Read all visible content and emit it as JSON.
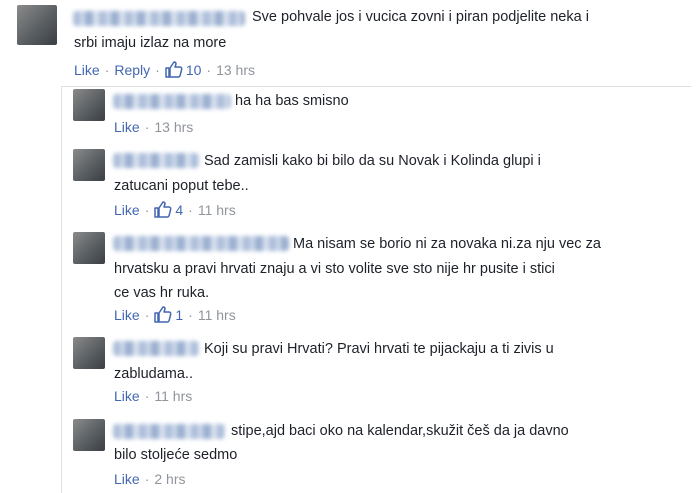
{
  "comments": [
    {
      "text_lines": [
        "Sve pohvale jos i vucica zovni i piran podjelite neka i",
        "srbi imaju izlaz na more"
      ],
      "like_label": "Like",
      "reply_label": "Reply",
      "like_count": "10",
      "time": "13 hrs"
    },
    {
      "text_lines": [
        "ha ha bas smisno"
      ],
      "like_label": "Like",
      "time": "13 hrs"
    },
    {
      "text_lines": [
        "Sad zamisli kako bi bilo da su Novak i Kolinda glupi i",
        "zatucani poput tebe.."
      ],
      "like_label": "Like",
      "like_count": "4",
      "time": "11 hrs"
    },
    {
      "text_lines": [
        "Ma nisam se borio ni za novaka ni.za nju vec za",
        "hrvatsku a pravi hrvati znaju a vi sto volite sve sto nije hr pusite i stici",
        "ce vas hr ruka."
      ],
      "like_label": "Like",
      "like_count": "1",
      "time": "11 hrs"
    },
    {
      "text_lines": [
        "Koji su pravi Hrvati? Pravi hrvati te pijackaju a ti zivis u",
        "zabludama.."
      ],
      "like_label": "Like",
      "time": "11 hrs"
    },
    {
      "text_lines": [
        "stipe,ajd baci oko na kalendar,skužit češ da ja davno",
        "bilo stoljeće sedmo"
      ],
      "like_label": "Like",
      "time": "2 hrs"
    }
  ],
  "separator": "·",
  "icons": {
    "like": "thumbs-up-icon"
  },
  "colors": {
    "link": "#4267b2",
    "meta": "#90949c",
    "text": "#1d2129"
  }
}
